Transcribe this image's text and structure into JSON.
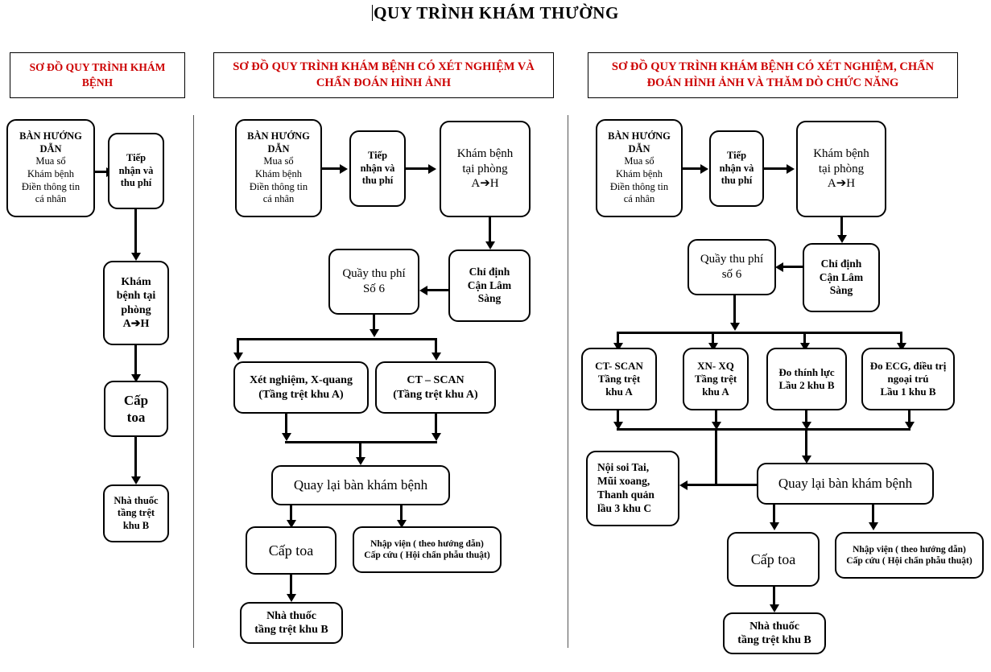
{
  "page": {
    "title": "QUY TRÌNH KHÁM THƯỜNG",
    "title_color": "#000000",
    "banner_color": "#cc0000",
    "background": "#ffffff"
  },
  "columns": [
    {
      "id": "col1",
      "banner": "SƠ ĐỒ QUY TRÌNH KHÁM BỆNH",
      "banner_lines": [
        "SƠ ĐỒ QUY TRÌNH",
        "KHÁM BỆNH"
      ],
      "nodes": [
        {
          "id": "c1-ban-huong-dan",
          "name": "ban-huong-dan",
          "lines": [
            "BÀN HƯỚNG",
            "DẪN",
            "Mua sổ",
            "Khám bệnh",
            "Điền thông tin",
            "cá nhân"
          ],
          "header_lines": 2
        },
        {
          "id": "c1-tiep-nhan",
          "name": "tiep-nhan-thu-phi",
          "lines": [
            "Tiếp",
            "nhận và",
            "thu phí"
          ],
          "header_lines": 0
        },
        {
          "id": "c1-kham-benh",
          "name": "kham-benh-tai-phong",
          "lines": [
            "Khám",
            "bệnh tại",
            "phòng",
            "A➔H"
          ],
          "header_lines": 0
        },
        {
          "id": "c1-cap-toa",
          "name": "cap-toa",
          "lines": [
            "Cấp",
            "toa"
          ],
          "header_lines": 0
        },
        {
          "id": "c1-nha-thuoc",
          "name": "nha-thuoc",
          "lines": [
            "Nhà thuốc",
            "tầng trệt",
            "khu B"
          ],
          "header_lines": 0
        }
      ]
    },
    {
      "id": "col2",
      "banner": "SƠ ĐỒ QUY TRÌNH KHÁM BỆNH CÓ XÉT NGHIỆM VÀ CHẨN ĐOÁN HÌNH ẢNH",
      "banner_lines": [
        "SƠ ĐỒ QUY TRÌNH KHÁM BỆNH CÓ XÉT NGHIỆM",
        "VÀ CHẨN ĐOÁN HÌNH ẢNH"
      ],
      "nodes": [
        {
          "id": "c2-ban-huong-dan",
          "name": "ban-huong-dan",
          "lines": [
            "BÀN HƯỚNG",
            "DẪN",
            "Mua sổ",
            "Khám bệnh",
            "Điền thông tin",
            "cá nhân"
          ],
          "header_lines": 2
        },
        {
          "id": "c2-tiep-nhan",
          "name": "tiep-nhan-thu-phi",
          "lines": [
            "Tiếp",
            "nhận và",
            "thu phí"
          ],
          "header_lines": 0
        },
        {
          "id": "c2-kham-benh",
          "name": "kham-benh-tai-phong",
          "lines": [
            "Khám bệnh",
            "tại phòng",
            "A➔H"
          ],
          "header_lines": 0
        },
        {
          "id": "c2-chi-dinh",
          "name": "chi-dinh-can-lam-sang",
          "lines": [
            "Chỉ định",
            "Cận Lâm",
            "Sàng"
          ],
          "header_lines": 0
        },
        {
          "id": "c2-quay-thu-phi",
          "name": "quay-thu-phi-so-6",
          "lines": [
            "Quầy thu phí",
            "Số 6"
          ],
          "header_lines": 0
        },
        {
          "id": "c2-xet-nghiem",
          "name": "xet-nghiem-x-quang",
          "lines": [
            "Xét nghiệm, X-quang",
            "(Tầng trệt khu A)"
          ],
          "header_lines": 0
        },
        {
          "id": "c2-ct-scan",
          "name": "ct-scan",
          "lines": [
            "CT – SCAN",
            "(Tầng trệt khu A)"
          ],
          "header_lines": 0
        },
        {
          "id": "c2-quay-lai",
          "name": "quay-lai-ban-kham-benh",
          "lines": [
            "Quay lại bàn khám bệnh"
          ],
          "header_lines": 0
        },
        {
          "id": "c2-cap-toa",
          "name": "cap-toa",
          "lines": [
            "Cấp toa"
          ],
          "header_lines": 0
        },
        {
          "id": "c2-nhap-vien",
          "name": "nhap-vien-cap-cuu",
          "lines": [
            "Nhập viện ( theo hướng dẫn)",
            "Cấp cứu ( Hội chẩn phẫu thuật)"
          ],
          "header_lines": 0
        },
        {
          "id": "c2-nha-thuoc",
          "name": "nha-thuoc",
          "lines": [
            "Nhà thuốc",
            "tầng trệt khu B"
          ],
          "header_lines": 0
        }
      ]
    },
    {
      "id": "col3",
      "banner": "SƠ ĐỒ QUY TRÌNH KHÁM BỆNH CÓ XÉT NGHIỆM, CHẨN ĐOÁN HÌNH ẢNH VÀ THĂM DÒ CHỨC NĂNG",
      "banner_lines": [
        "SƠ ĐỒ QUY TRÌNH KHÁM BỆNH CÓ XÉT NGHIỆM, CHẨN",
        "ĐOÁN HÌNH ẢNH VÀ THĂM DÒ CHỨC NĂNG"
      ],
      "nodes": [
        {
          "id": "c3-ban-huong-dan",
          "name": "ban-huong-dan",
          "lines": [
            "BÀN HƯỚNG",
            "DẪN",
            "Mua sổ",
            "Khám bệnh",
            "Điền thông tin",
            "cá nhân"
          ],
          "header_lines": 2
        },
        {
          "id": "c3-tiep-nhan",
          "name": "tiep-nhan-thu-phi",
          "lines": [
            "Tiếp",
            "nhận và",
            "thu phí"
          ],
          "header_lines": 0
        },
        {
          "id": "c3-kham-benh",
          "name": "kham-benh-tai-phong",
          "lines": [
            "Khám bệnh",
            "tại phòng",
            "A➔H"
          ],
          "header_lines": 0
        },
        {
          "id": "c3-chi-dinh",
          "name": "chi-dinh-can-lam-sang",
          "lines": [
            "Chỉ định",
            "Cận Lâm",
            "Sàng"
          ],
          "header_lines": 0
        },
        {
          "id": "c3-quay-thu-phi",
          "name": "quay-thu-phi-so-6",
          "lines": [
            "Quầy thu phí",
            "số 6"
          ],
          "header_lines": 0
        },
        {
          "id": "c3-ct-scan",
          "name": "ct-scan",
          "lines": [
            "CT- SCAN",
            "Tầng trệt",
            "khu A"
          ],
          "header_lines": 0
        },
        {
          "id": "c3-xn-xq",
          "name": "xn-xq",
          "lines": [
            "XN- XQ",
            "Tầng trệt",
            "khu A"
          ],
          "header_lines": 0
        },
        {
          "id": "c3-do-thinh-luc",
          "name": "do-thinh-luc",
          "lines": [
            "Đo thính lực",
            "Lầu 2 khu B"
          ],
          "header_lines": 0
        },
        {
          "id": "c3-do-ecg",
          "name": "do-ecg-dieu-tri-ngoai-tru",
          "lines": [
            "Đo ECG, điều trị",
            "ngoại trú",
            "Lầu 1 khu B"
          ],
          "header_lines": 0
        },
        {
          "id": "c3-noi-soi",
          "name": "noi-soi-tai-mui-xoang",
          "lines": [
            "Nội soi Tai,",
            "Mũi xoang,",
            "Thanh quản",
            "lầu 3 khu C"
          ],
          "header_lines": 0
        },
        {
          "id": "c3-quay-lai",
          "name": "quay-lai-ban-kham-benh",
          "lines": [
            "Quay lại bàn khám bệnh"
          ],
          "header_lines": 0
        },
        {
          "id": "c3-cap-toa",
          "name": "cap-toa",
          "lines": [
            "Cấp toa"
          ],
          "header_lines": 0
        },
        {
          "id": "c3-nhap-vien",
          "name": "nhap-vien-cap-cuu",
          "lines": [
            "Nhập viện ( theo hướng dẫn)",
            "Cấp cứu ( Hội chẩn phẫu thuật)"
          ],
          "header_lines": 0
        },
        {
          "id": "c3-nha-thuoc",
          "name": "nha-thuoc",
          "lines": [
            "Nhà thuốc",
            "tầng trệt khu B"
          ],
          "header_lines": 0
        }
      ]
    }
  ]
}
